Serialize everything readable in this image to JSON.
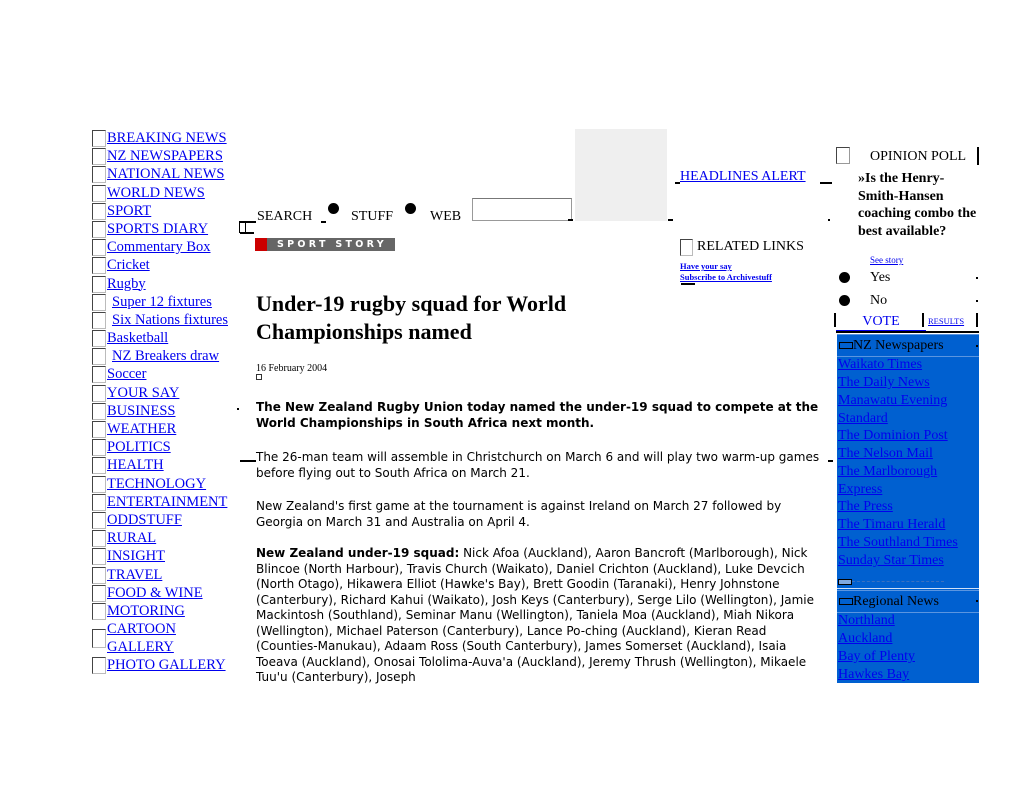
{
  "nav": {
    "items": [
      {
        "label": "BREAKING NEWS"
      },
      {
        "label": "NZ NEWSPAPERS"
      },
      {
        "label": "NATIONAL NEWS"
      },
      {
        "label": "WORLD NEWS"
      },
      {
        "label": "SPORT"
      },
      {
        "label": "SPORTS DIARY"
      },
      {
        "label": "Commentary Box"
      },
      {
        "label": "Cricket"
      },
      {
        "label": "Rugby"
      },
      {
        "label": "Super 12 fixtures"
      },
      {
        "label": "Six Nations fixtures"
      },
      {
        "label": "Basketball"
      },
      {
        "label": "NZ Breakers draw"
      },
      {
        "label": "Soccer"
      },
      {
        "label": "YOUR SAY"
      },
      {
        "label": "BUSINESS"
      },
      {
        "label": "WEATHER"
      },
      {
        "label": "POLITICS"
      },
      {
        "label": "HEALTH"
      },
      {
        "label": "TECHNOLOGY"
      },
      {
        "label": "ENTERTAINMENT"
      },
      {
        "label": "ODDSTUFF"
      },
      {
        "label": "RURAL"
      },
      {
        "label": "INSIGHT"
      },
      {
        "label": "TRAVEL"
      },
      {
        "label": "FOOD & WINE"
      },
      {
        "label": "MOTORING"
      },
      {
        "label": "CARTOON GALLERY"
      },
      {
        "label": "PHOTO GALLERY"
      }
    ]
  },
  "search": {
    "label": "SEARCH",
    "option_stuff": "STUFF",
    "option_web": "WEB",
    "input_value": ""
  },
  "headlines_alert": "HEADLINES ALERT",
  "section_banner": "SPORT STORY",
  "article": {
    "title": "Under-19 rugby squad for World Championships named",
    "date": "16 February 2004",
    "lead": "The New Zealand Rugby Union today named the under-19 squad to compete at the World Championships in South Africa next month.",
    "para1": "The 26-man team will assemble in Christchurch on March 6 and will play two warm-up games before flying out to South Africa on March 21.",
    "para2": "New Zealand's first game at the tournament is against Ireland on March 27 followed by Georgia on March 31 and Australia on April 4.",
    "squad_label": "New Zealand under-19 squad:",
    "squad_text": " Nick Afoa (Auckland), Aaron Bancroft (Marlborough), Nick Blincoe (North Harbour), Travis Church (Waikato), Daniel Crichton (Auckland), Luke Devcich (North Otago), Hikawera Elliot (Hawke's Bay), Brett Goodin (Taranaki), Henry Johnstone (Canterbury), Richard Kahui (Waikato), Josh Keys (Canterbury), Serge Lilo (Wellington), Jamie Mackintosh (Southland), Seminar Manu (Wellington), Taniela Moa (Auckland), Miah Nikora (Wellington), Michael Paterson (Canterbury), Lance Po-ching (Auckland), Kieran Read (Counties-Manukau), Adaam Ross (South Canterbury), James Somerset (Auckland), Isaia Toeava (Auckland), Onosai Tololima-Auva'a (Auckland), Jeremy Thrush (Wellington), Mikaele Tuu'u (Canterbury), Joseph"
  },
  "related": {
    "title": "RELATED LINKS",
    "links": [
      "Have your say",
      "Subscribe to Archivestuff"
    ]
  },
  "poll": {
    "title": "OPINION POLL",
    "question": "»Is the Henry-Smith-Hansen coaching combo the best available?",
    "see_story": "See story",
    "options": [
      "Yes",
      "No"
    ],
    "vote_label": "VOTE",
    "results_label": "RESULTS"
  },
  "panel": {
    "color": "#0060d0",
    "nz_newspapers_title": "NZ Newspapers",
    "nz_newspapers": [
      "Waikato Times",
      "The Daily News",
      "Manawatu Evening",
      "Standard",
      "The Dominion Post",
      "The Nelson Mail",
      "The Marlborough",
      "Express",
      "The Press",
      "The Timaru Herald",
      "The Southland Times",
      "Sunday Star Times"
    ],
    "regional_title": "Regional News",
    "regional": [
      "Northland",
      "Auckland",
      "Bay of Plenty",
      "Hawkes Bay"
    ]
  }
}
